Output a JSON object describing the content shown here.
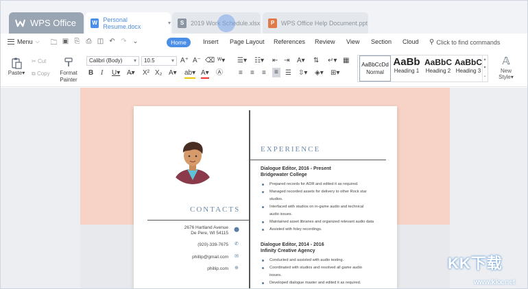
{
  "tabs": {
    "home": "WPS Office",
    "documents": [
      {
        "label": "Personal Resume.docx",
        "type": "W",
        "color": "#4b8ee8",
        "active": true
      },
      {
        "label": "2019 Work Schedule.xlsx",
        "type": "S",
        "color": "#8c96a3",
        "active": false
      },
      {
        "label": "WPS Office Help Document.ppt",
        "type": "P",
        "color": "#e07a4a",
        "active": false
      }
    ]
  },
  "menubar": {
    "menu_label": "Menu",
    "ribbon_tabs": [
      "Home",
      "Insert",
      "Page Layout",
      "References",
      "Review",
      "View",
      "Section",
      "Cloud"
    ],
    "find_placeholder": "Click to find commands"
  },
  "ribbon": {
    "paste": "Paste",
    "cut": "Cut",
    "copy": "Copy",
    "format_painter_1": "Format",
    "format_painter_2": "Painter",
    "font_name": "Calibri (Body)",
    "font_size": "10.5",
    "styles": [
      {
        "preview": "AaBbCcDd",
        "name": "Normal"
      },
      {
        "preview": "AaBb",
        "name": "Heading 1"
      },
      {
        "preview": "AaBbC",
        "name": "Heading 2"
      },
      {
        "preview": "AaBbC",
        "name": "Heading 3"
      }
    ],
    "new_style": "New Style"
  },
  "resume": {
    "contacts_title": "CONTACTS",
    "address_1": "2676 Hartland Avenue",
    "address_2": "De Pere, WI 54115",
    "phone": "(920)-339-7675",
    "email": "phillip@gmail.com",
    "website": "phillip.com",
    "experience_title": "EXPERIENCE",
    "jobs": [
      {
        "title": "Dialogue Editor, 2016 - Present",
        "company": "Bridgewater College",
        "bullets": [
          "Prepared records for ADR and edited it as required.",
          "Managed recorded assets for delivery to other Rock star",
          "studios.",
          "Interfaced with studios on in-game audio and technical",
          "audio issues.",
          "Maintained asset libraries and organized relevant audio data",
          "Assisted with foley recordings."
        ]
      },
      {
        "title": "Dialogue Editor, 2014 - 2016",
        "company": "Infinity Creative Agency",
        "bullets": [
          "Conducted and assisted with audio testing.",
          "Coordinated with studios and resolved all game audio",
          "issues.",
          "Developed dialogue master and edited it as required."
        ]
      }
    ]
  },
  "watermark": {
    "text": "KK下载",
    "url": "www.kkx.net"
  }
}
